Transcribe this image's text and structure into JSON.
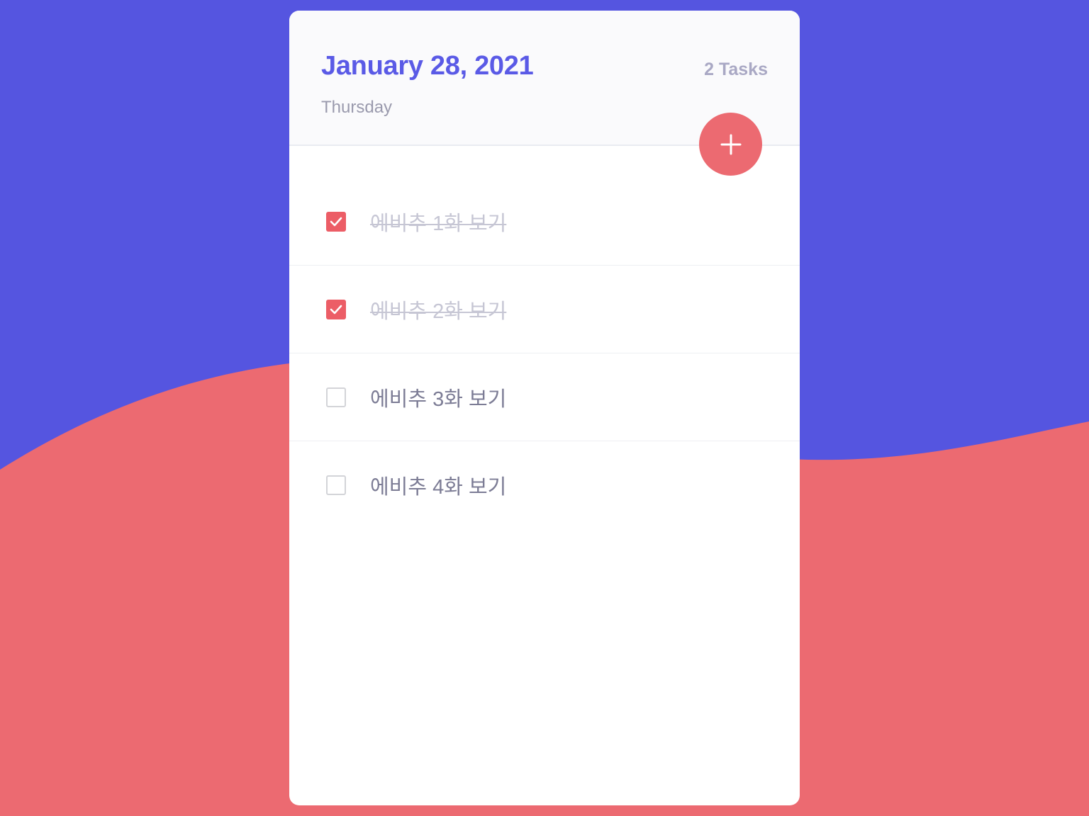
{
  "colors": {
    "background_top": "#5555e0",
    "background_bottom": "#ec6a71",
    "title": "#5a5ae6",
    "accent": "#ec5d66"
  },
  "header": {
    "date": "January 28, 2021",
    "weekday": "Thursday",
    "task_count": "2 Tasks"
  },
  "add_button": {
    "icon": "plus-icon"
  },
  "tasks": [
    {
      "text": "에비추 1화 보기",
      "done": true
    },
    {
      "text": "에비추 2화 보기",
      "done": true
    },
    {
      "text": "에비추 3화 보기",
      "done": false
    },
    {
      "text": "에비추 4화 보기",
      "done": false
    }
  ]
}
